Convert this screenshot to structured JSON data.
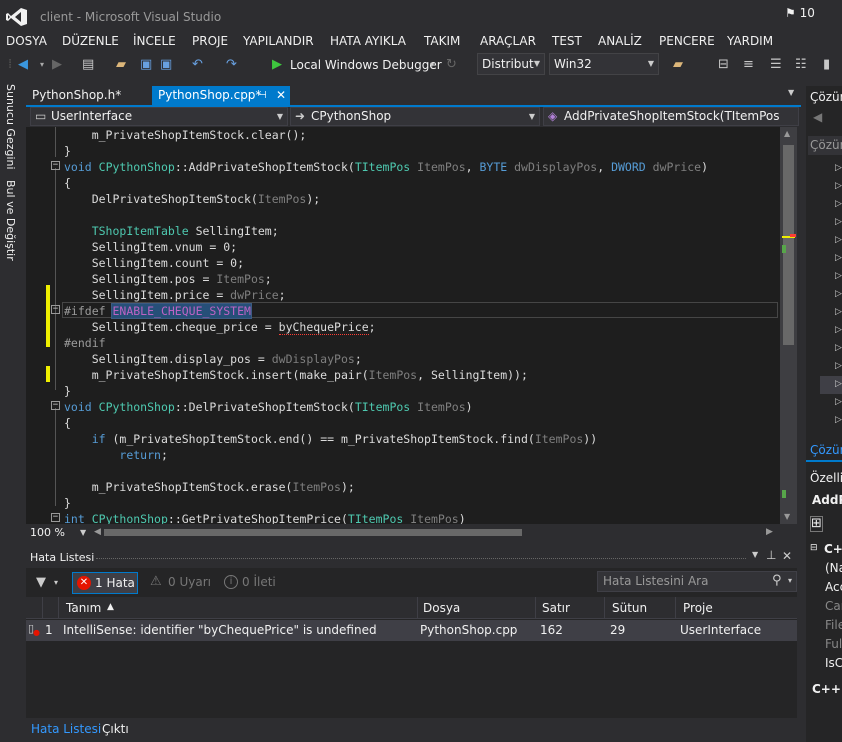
{
  "window": {
    "title": "client - Microsoft Visual Studio",
    "notification_count": "10"
  },
  "menu": [
    "DOSYA",
    "DÜZENLE",
    "İNCELE",
    "PROJE",
    "YAPILANDIR",
    "HATA AYIKLA",
    "TAKIM",
    "ARAÇLAR",
    "TEST",
    "ANALİZ",
    "PENCERE",
    "YARDIM"
  ],
  "toolbar": {
    "debugger_label": "Local Windows Debugger",
    "config": "Distribut",
    "platform": "Win32"
  },
  "left_strip": {
    "server_explorer": "Sunucu Gezgini",
    "find_replace": "Bul ve Değiştir"
  },
  "tabs": [
    {
      "label": "PythonShop.h*"
    },
    {
      "label": "PythonShop.cpp*"
    }
  ],
  "nav": {
    "project": "UserInterface",
    "class": "CPythonShop",
    "member": "AddPrivateShopItemStock(TItemPos Item"
  },
  "zoom": "100 %",
  "error_list": {
    "title": "Hata Listesi",
    "errors_btn": "1 Hata",
    "warnings_btn": "0 Uyarı",
    "messages_btn": "0 İleti",
    "search_placeholder": "Hata Listesini Ara",
    "columns": [
      "Tanım",
      "Dosya",
      "Satır",
      "Sütun",
      "Proje"
    ],
    "rows": [
      {
        "num": "1",
        "desc": "IntelliSense: identifier \"byChequePrice\" is undefined",
        "file": "PythonShop.cpp",
        "line": "162",
        "col": "29",
        "project": "UserInterface"
      }
    ],
    "bottom_tabs": [
      "Hata Listesi",
      "Çıktı"
    ]
  },
  "right_panel": {
    "sol_title": "Çözüm",
    "sol_search": "Çözüm",
    "props_title": "Özellik",
    "props_name": "AddP",
    "props_items": [
      "C++",
      "(Na",
      "Acc",
      "Can",
      "File",
      "Full",
      "IsC"
    ],
    "props_footer": "C++",
    "sol_tab": "Çözüm"
  },
  "colors": {
    "accent": "#007acc",
    "bg": "#1e1e1e",
    "keyword": "#569cd6",
    "type": "#4ec9b0",
    "param": "#7f7f7f",
    "macro": "#bd63c5"
  }
}
